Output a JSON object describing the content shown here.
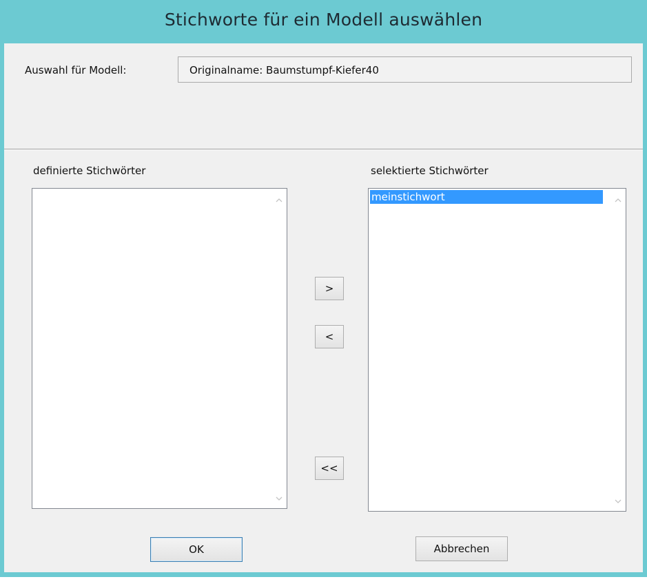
{
  "window": {
    "title": "Stichworte für ein Modell auswählen"
  },
  "model": {
    "label": "Auswahl für Modell:",
    "value": "Originalname: Baumstumpf-Kiefer40"
  },
  "defined_keywords": {
    "caption": "definierte Stichwörter",
    "items": []
  },
  "selected_keywords": {
    "caption": "selektierte Stichwörter",
    "items": [
      "meinstichwort"
    ],
    "selected_index": 0
  },
  "transfer_buttons": {
    "move_right": ">",
    "move_left": "<",
    "move_all_left": "<<"
  },
  "dialog_buttons": {
    "ok": "OK",
    "cancel": "Abbrechen"
  },
  "colors": {
    "titlebar": "#6ccad2",
    "client_bg": "#f0f0f0",
    "selection": "#3399ff"
  },
  "icons": {
    "scroll_up": "chevron-up-icon",
    "scroll_down": "chevron-down-icon"
  }
}
